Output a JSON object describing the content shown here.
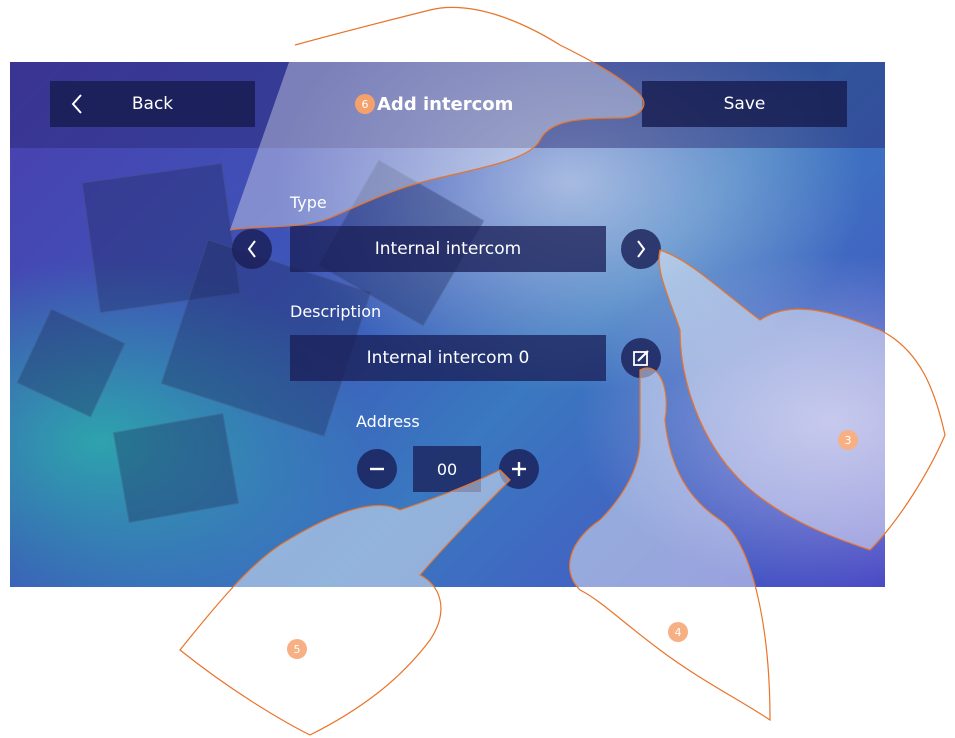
{
  "header": {
    "back_label": "Back",
    "title": "Add intercom",
    "save_label": "Save",
    "title_step": "6"
  },
  "type": {
    "label": "Type",
    "value": "Internal intercom"
  },
  "description": {
    "label": "Description",
    "value": "Internal intercom 0"
  },
  "address": {
    "label": "Address",
    "value": "00"
  },
  "callouts": {
    "right": "3",
    "edit": "4",
    "plus": "5"
  },
  "colors": {
    "accent": "#ee6f1e",
    "button_bg": "#1a1f55",
    "text": "#ffffff"
  },
  "icons": [
    "chevron-left-icon",
    "chevron-right-icon",
    "edit-icon",
    "minus-icon",
    "plus-icon"
  ]
}
